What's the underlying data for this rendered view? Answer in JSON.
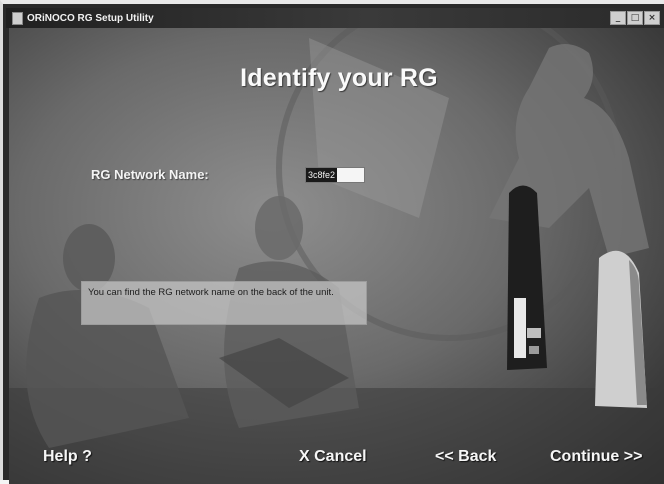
{
  "window": {
    "title": "ORiNOCO RG Setup Utility",
    "controls": [
      "_",
      "□",
      "×"
    ]
  },
  "main": {
    "heading": "Identify your RG",
    "network_name_label": "RG Network Name:",
    "network_name_value": "3c8fe2",
    "hint_text": "You can find the RG network name on the back of the unit."
  },
  "footer": {
    "help_label": "Help ?",
    "cancel_label": "X Cancel",
    "back_label": "<< Back",
    "continue_label": "Continue >>"
  }
}
